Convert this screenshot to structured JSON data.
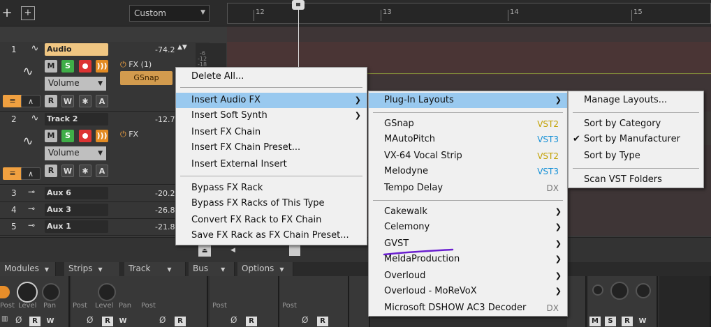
{
  "toolbar": {
    "preset_value": "Custom"
  },
  "ruler": {
    "marks": [
      "12",
      "13",
      "14",
      "15"
    ]
  },
  "tracks": [
    {
      "num": "1",
      "name": "Audio",
      "value": "-74.2",
      "fx_label": "FX (1)",
      "plugin": "GSnap",
      "automation": "Volume"
    },
    {
      "num": "2",
      "name": "Track 2",
      "value": "-12.7",
      "fx_label": "FX",
      "automation": "Volume"
    },
    {
      "num": "3",
      "name": "Aux 6",
      "value": "-20.2"
    },
    {
      "num": "4",
      "name": "Aux 3",
      "value": "-26.8"
    },
    {
      "num": "5",
      "name": "Aux 1",
      "value": "-21.8"
    }
  ],
  "meter_scale": [
    "-6",
    "-12",
    "-18"
  ],
  "buttons": {
    "mute": "M",
    "solo": "S",
    "read": "R",
    "write": "W",
    "star": "✱",
    "auto": "A"
  },
  "bottom_tabs": [
    "Modules",
    "Strips",
    "Track",
    "Bus",
    "Options"
  ],
  "strip_labels": {
    "post": "Post",
    "level": "Level",
    "pan": "Pan"
  },
  "context_menu": {
    "items": [
      "Delete All...",
      "Insert Audio FX",
      "Insert Soft Synth",
      "Insert FX Chain",
      "Insert FX Chain Preset...",
      "Insert External Insert",
      "Bypass FX Rack",
      "Bypass FX Racks of This Type",
      "Convert FX Rack to FX Chain",
      "Save FX Rack as FX Chain Preset..."
    ]
  },
  "fx_menu": {
    "layouts": "Plug-In Layouts",
    "plugins": [
      {
        "name": "GSnap",
        "tag": "VST2"
      },
      {
        "name": "MAutoPitch",
        "tag": "VST3"
      },
      {
        "name": "VX-64 Vocal Strip",
        "tag": "VST2"
      },
      {
        "name": "Melodyne",
        "tag": "VST3"
      },
      {
        "name": "Tempo Delay",
        "tag": "DX"
      }
    ],
    "vendors": [
      "Cakewalk",
      "Celemony",
      "GVST",
      "MeldaProduction",
      "Overloud",
      "Overloud - MoReVoX"
    ],
    "last": {
      "name": "Microsoft DSHOW AC3 Decoder",
      "tag": "DX"
    }
  },
  "layout_menu": {
    "items": [
      "Manage Layouts...",
      "Sort by Category",
      "Sort by Manufacturer",
      "Sort by Type",
      "Scan VST Folders"
    ],
    "checked": "Sort by Manufacturer"
  },
  "colors": {
    "highlight": "#99c9ef",
    "vst2": "#c2a000",
    "vst3": "#1590d6",
    "selected_track": "#f0c682",
    "annotation": "#6a1fd0"
  }
}
